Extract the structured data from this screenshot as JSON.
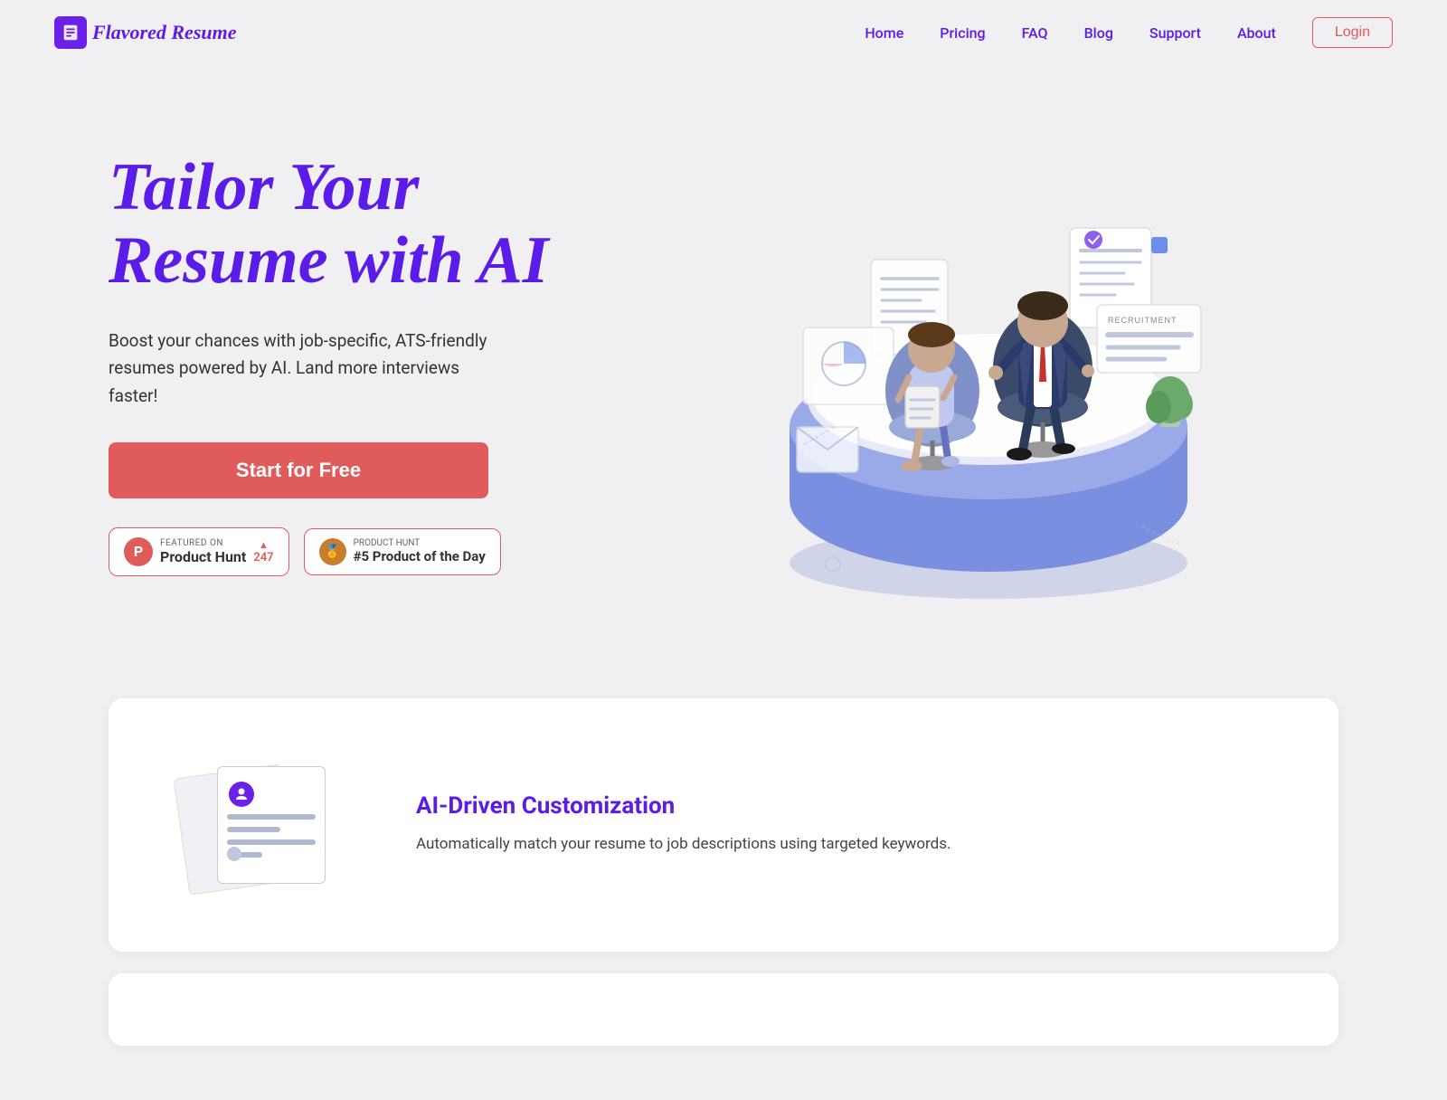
{
  "nav": {
    "logo_text": "Flavored Resume",
    "links": [
      {
        "label": "Home",
        "id": "home"
      },
      {
        "label": "Pricing",
        "id": "pricing"
      },
      {
        "label": "FAQ",
        "id": "faq"
      },
      {
        "label": "Blog",
        "id": "blog"
      },
      {
        "label": "Support",
        "id": "support"
      },
      {
        "label": "About",
        "id": "about"
      }
    ],
    "login_label": "Login"
  },
  "hero": {
    "title_line1": "Tailor Your",
    "title_line2": "Resume with AI",
    "subtitle": "Boost your chances with job-specific, ATS-friendly resumes powered by AI. Land more interviews faster!",
    "cta_label": "Start for Free",
    "badge1": {
      "featured_label": "FEATURED ON",
      "name": "Product Hunt",
      "count": "247",
      "arrow": "▲"
    },
    "badge2": {
      "label": "PRODUCT HUNT",
      "rank": "#5 Product of the Day"
    }
  },
  "features": [
    {
      "title": "AI-Driven Customization",
      "desc": "Automatically match your resume to job descriptions using targeted keywords."
    }
  ],
  "colors": {
    "purple": "#5b1be8",
    "coral": "#e05c5c",
    "bg": "#f0f0f3"
  }
}
